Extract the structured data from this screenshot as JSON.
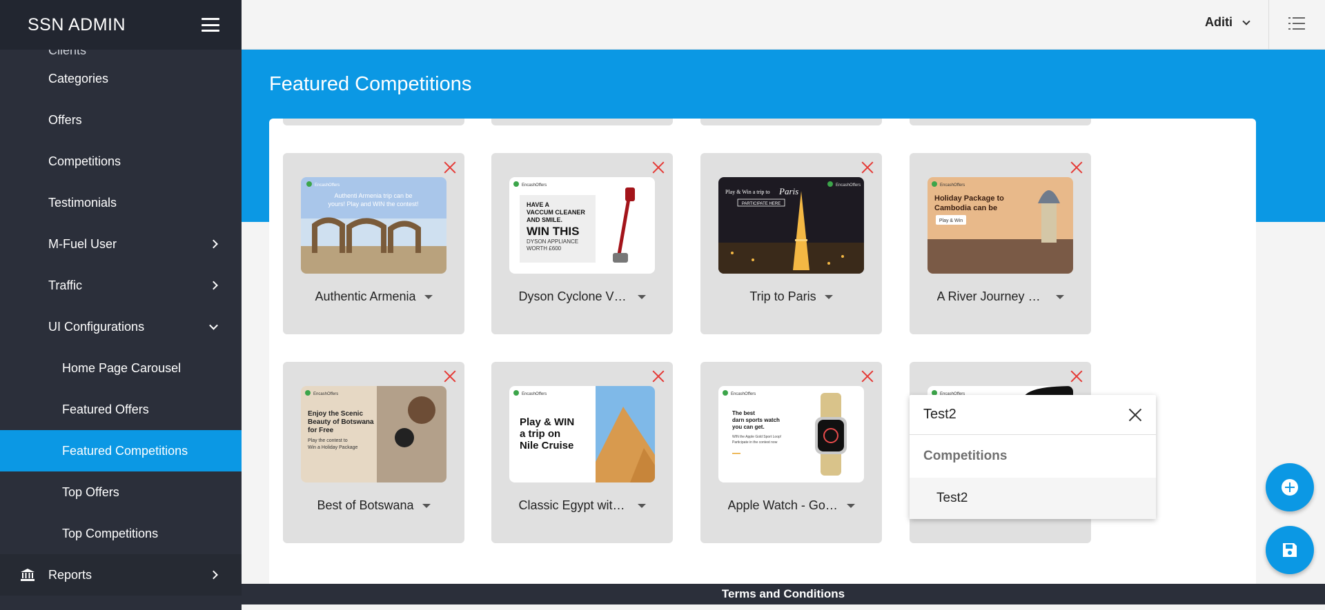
{
  "sidebar": {
    "brand": "SSN ADMIN",
    "partial_item": "Clients",
    "items": [
      {
        "label": "Categories"
      },
      {
        "label": "Offers"
      },
      {
        "label": "Competitions"
      },
      {
        "label": "Testimonials"
      },
      {
        "label": "M-Fuel User"
      },
      {
        "label": "Traffic"
      },
      {
        "label": "UI Configurations"
      },
      {
        "label": "Home Page Carousel"
      },
      {
        "label": "Featured Offers"
      },
      {
        "label": "Featured Competitions"
      },
      {
        "label": "Top Offers"
      },
      {
        "label": "Top Competitions"
      },
      {
        "label": "Reports"
      }
    ]
  },
  "header": {
    "user_name": "Aditi"
  },
  "page": {
    "title": "Featured Competitions"
  },
  "cards": [
    {
      "label": "Authentic Armenia",
      "image_text": [
        "Authenti Armenia trip can be",
        "yours! Play and WIN the contest!"
      ]
    },
    {
      "label": "Dyson Cyclone V1…",
      "image_text": [
        "HAVE A",
        "VACCUM CLEANER",
        "AND SMILE.",
        "WIN THIS",
        "DYSON APPLIANCE",
        "WORTH £600"
      ]
    },
    {
      "label": "Trip to Paris",
      "image_text": [
        "Play & Win a trip to",
        "Paris",
        "PARTICIPATE HERE"
      ]
    },
    {
      "label": "A River Journey o…",
      "image_text": [
        "Holiday Package to",
        "Cambodia can be",
        "Play & Win"
      ]
    },
    {
      "label": "Best of Botswana",
      "image_text": [
        "Enjoy the Scenic",
        "Beauty of Botswana",
        "for Free",
        "Play the contest to",
        "Win a Holiday Package"
      ]
    },
    {
      "label": "Classic Egypt with…",
      "image_text": [
        "Play & WIN",
        "a trip on",
        "Nile Cruise"
      ]
    },
    {
      "label": "Apple Watch - Gol…",
      "image_text": [
        "The best",
        "darn sports watch",
        "you can get.",
        "WIN the Apple Gold Sport Loop!",
        "Participate in the contest now"
      ]
    }
  ],
  "brand_tag": "EncashOffers",
  "search": {
    "value": "Test2",
    "group_label": "Competitions",
    "options": [
      "Test2"
    ]
  },
  "footer": {
    "label": "Terms and Conditions"
  },
  "colors": {
    "accent": "#0b98e4",
    "sidebar": "#2b2f3a",
    "close": "#e53935"
  }
}
